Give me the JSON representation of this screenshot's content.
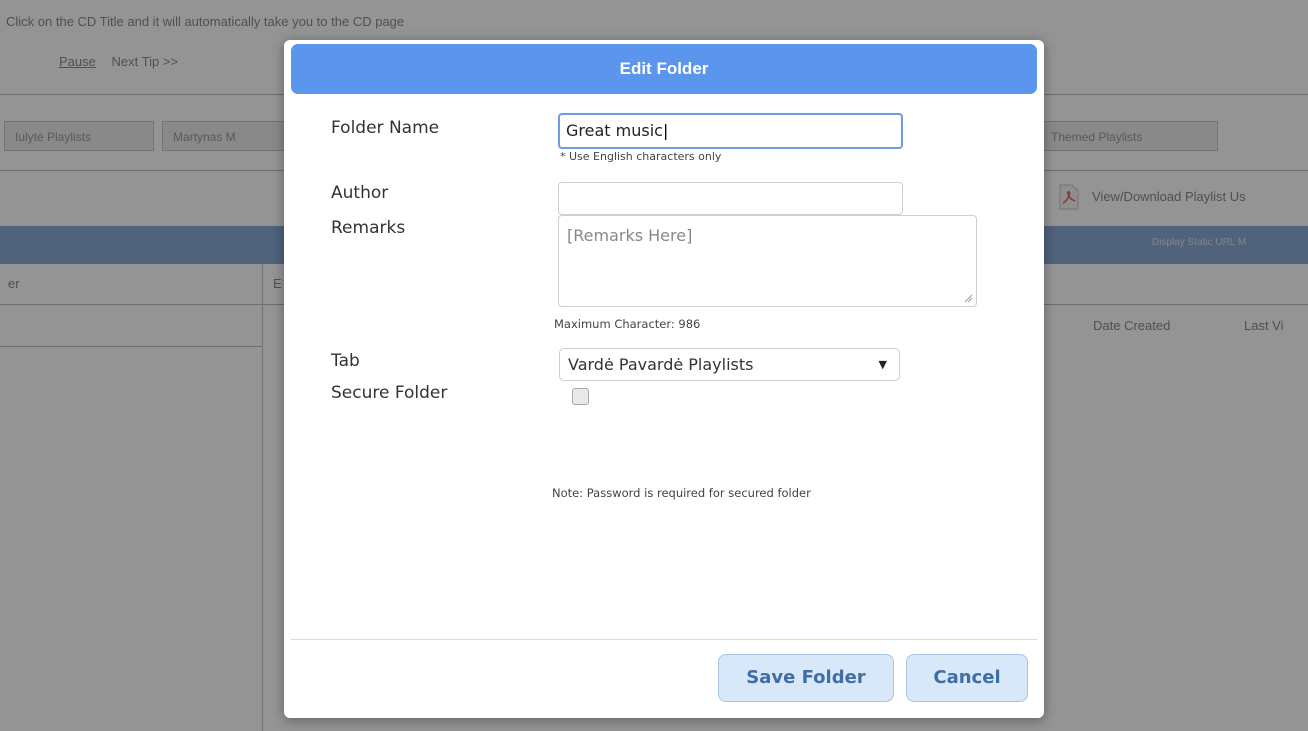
{
  "background": {
    "tip_text": "Click on the CD Title and it will automatically take you to the CD page",
    "pause_label": "Pause",
    "next_tip_label": "Next Tip >>",
    "tabs": [
      "Iulytė Playlists",
      "Martynas M",
      "Themed Playlists"
    ],
    "pdf_link": "View/Download Playlist Us",
    "blue_bar_text": "Display Static URL M",
    "col_left_header": "er",
    "col_e": "E",
    "col_date_created": "Date Created",
    "col_last_visited": "Last Vi"
  },
  "dialog": {
    "title": "Edit Folder",
    "folder_name_label": "Folder Name",
    "folder_name_value": "Great music",
    "folder_name_hint": "* Use English characters only",
    "author_label": "Author",
    "author_value": "",
    "remarks_label": "Remarks",
    "remarks_placeholder": "[Remarks Here]",
    "max_chars_text": "Maximum Character: 986",
    "tab_label": "Tab",
    "tab_selected": "Vardė Pavardė Playlists",
    "secure_label": "Secure Folder",
    "secure_checked": false,
    "note_text": "Note: Password is required for secured folder",
    "save_label": "Save Folder",
    "cancel_label": "Cancel"
  },
  "colors": {
    "header_blue": "#5b95ee",
    "button_bg": "#d9e8f8",
    "button_text": "#3e6ea5"
  }
}
